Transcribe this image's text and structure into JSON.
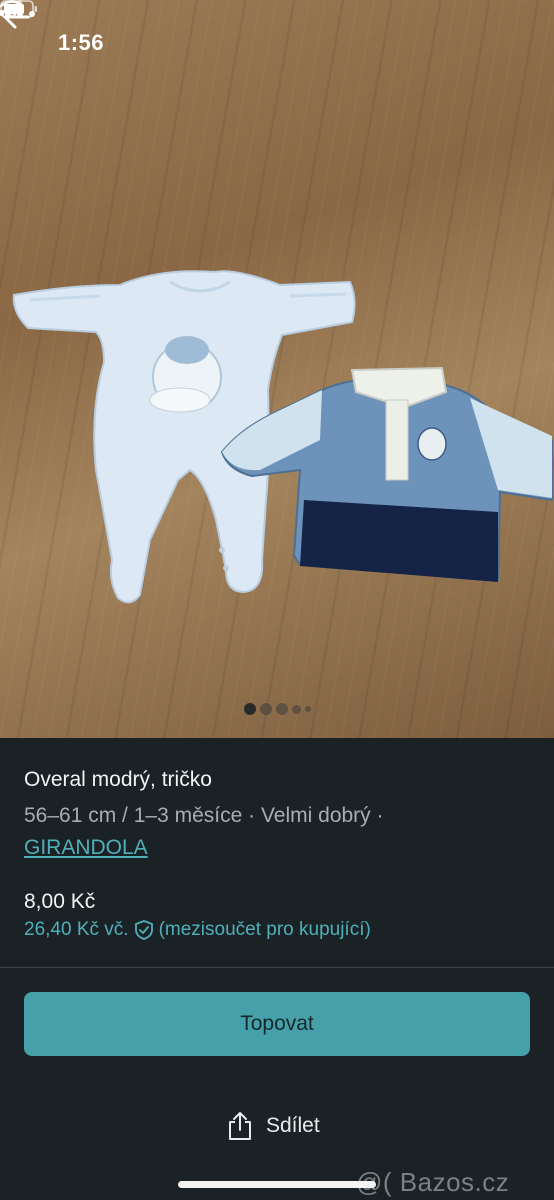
{
  "status_bar": {
    "time": "1:56"
  },
  "nav": {
    "back_icon": "arrow-left-icon",
    "more_icon": "more-horizontal-icon"
  },
  "gallery": {
    "image_count": 5,
    "current_index": 1
  },
  "listing": {
    "title": "Overal modrý, tričko",
    "details": "56–61 cm / 1–3 měsíce · Velmi dobrý ·",
    "brand": "GIRANDOLA",
    "price": "8,00 Kč",
    "price_incl": "26,40 Kč vč.",
    "price_incl_note": "(mezisoučet pro kupující)"
  },
  "actions": {
    "promote_label": "Topovat",
    "share_label": "Sdílet"
  },
  "watermark": "@( Bazos.cz",
  "colors": {
    "accent": "#46a0a9",
    "link": "#4fb0b9",
    "background": "#1b2226"
  }
}
